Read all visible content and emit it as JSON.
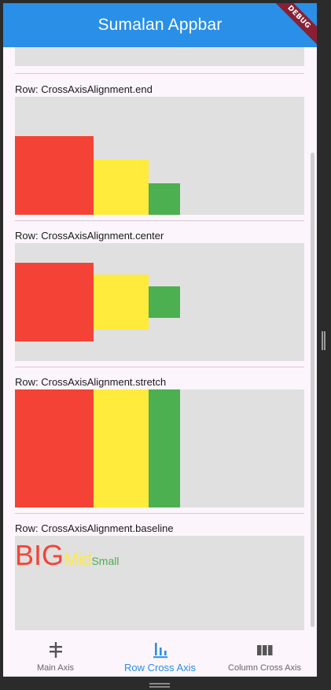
{
  "appbar": {
    "title": "Sumalan Appbar",
    "debug_label": "DEBUG"
  },
  "sections": {
    "end": {
      "title": "Row: CrossAxisAlignment.end"
    },
    "center": {
      "title": "Row: CrossAxisAlignment.center"
    },
    "stretch": {
      "title": "Row: CrossAxisAlignment.stretch"
    },
    "baseline": {
      "title": "Row: CrossAxisAlignment.baseline",
      "texts": [
        "BIG",
        "Mid",
        "Small"
      ]
    }
  },
  "colors": {
    "appbar": "#2a8fe6",
    "red": "#f44336",
    "yellow": "#ffeb3b",
    "green": "#4caf50",
    "box": "#e0e0e0"
  },
  "bottom_nav": {
    "items": [
      {
        "label": "Main Axis",
        "icon": "main-axis-icon",
        "active": false
      },
      {
        "label": "Row Cross Axis",
        "icon": "row-cross-axis-icon",
        "active": true
      },
      {
        "label": "Column Cross Axis",
        "icon": "column-cross-axis-icon",
        "active": false
      }
    ]
  }
}
